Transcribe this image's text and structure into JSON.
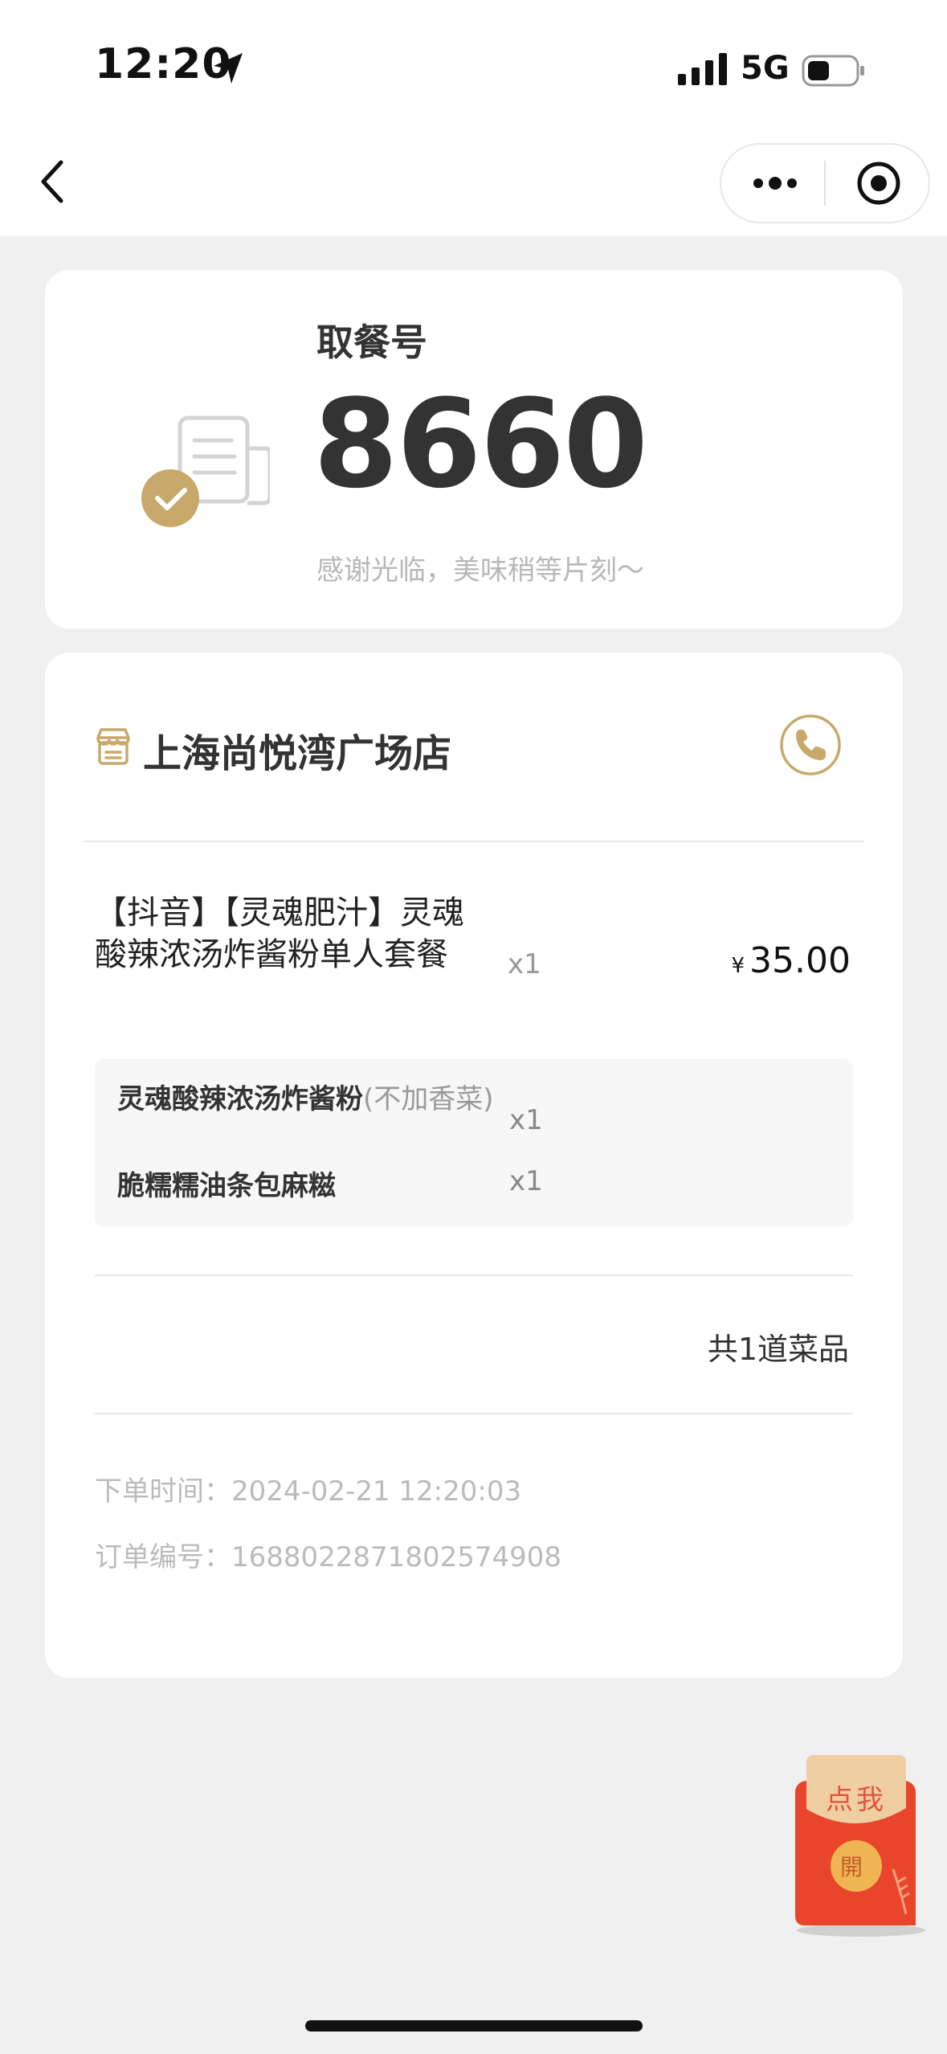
{
  "status_bar": {
    "time": "12:20",
    "network": "5G"
  },
  "nav": {
    "back_icon": "chevron-left-icon",
    "more_icon": "more-dots-icon",
    "target_icon": "record-target-icon"
  },
  "pickup": {
    "label": "取餐号",
    "number": "8660",
    "message": "感谢光临，美味稍等片刻～"
  },
  "store": {
    "name": "上海尚悦湾广场店",
    "phone_icon": "phone-icon"
  },
  "order_item": {
    "name": "【抖音】【灵魂肥汁】灵魂酸辣浓汤炸酱粉单人套餐",
    "quantity": "x1",
    "currency": "¥",
    "price": "35.00",
    "sub_items": [
      {
        "name": "灵魂酸辣浓汤炸酱粉",
        "note": "(不加香菜)",
        "quantity": "x1"
      },
      {
        "name": "脆糯糯油条包麻糍",
        "note": "",
        "quantity": "x1"
      }
    ]
  },
  "summary": {
    "total_dishes": "共1道菜品"
  },
  "order_meta": {
    "time_label": "下单时间：",
    "time_value": "2024-02-21 12:20:03",
    "number_label": "订单编号：",
    "number_value": "1688022871802574908"
  },
  "red_packet": {
    "label": "点我",
    "coin": "開"
  },
  "colors": {
    "accent_gold": "#c9a96b",
    "background": "#f0f0f0",
    "card": "#ffffff",
    "envelope_red": "#e9452c"
  }
}
